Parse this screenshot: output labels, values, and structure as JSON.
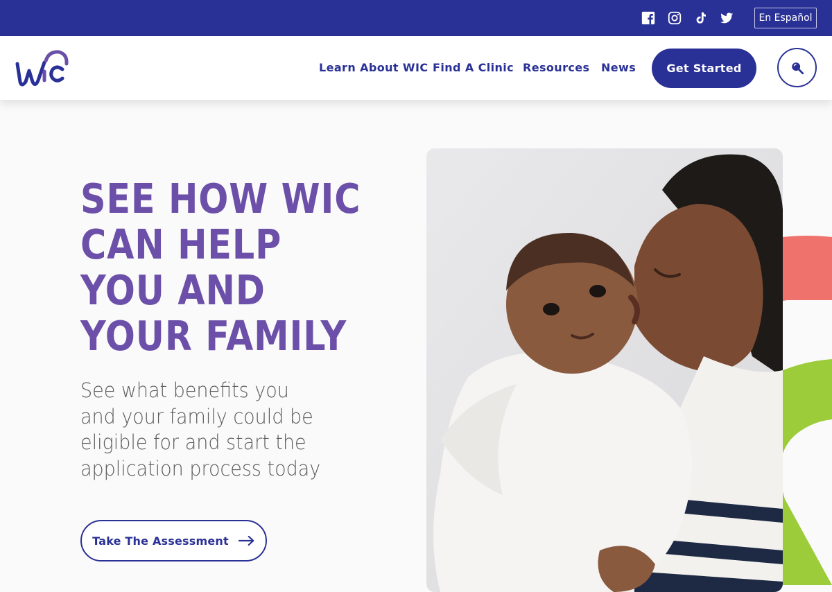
{
  "topbar": {
    "social_icons": [
      "facebook-icon",
      "instagram-icon",
      "tiktok-icon",
      "twitter-icon"
    ],
    "language_label": "En Español"
  },
  "navbar": {
    "logo_text": "wic",
    "links": [
      {
        "label": "Learn About WIC"
      },
      {
        "label": "Find A Clinic"
      },
      {
        "label": "Resources"
      },
      {
        "label": "News"
      }
    ],
    "cta_label": "Get Started",
    "search_icon": "search-icon"
  },
  "hero": {
    "title_lines": [
      "SEE HOW WIC",
      "CAN HELP",
      "YOU AND",
      "YOUR FAMILY"
    ],
    "subtitle": "See what benefits you and your family could be eligible for and start the application process today",
    "button_label": "Take The Assessment",
    "button_icon": "arrow-right-icon",
    "image_alt": "mother-kissing-baby-photo"
  },
  "colors": {
    "brand_navy": "#2a3196",
    "headline_purple": "#6b4fa8",
    "accent_coral": "#ef736c",
    "accent_green": "#9ccc3a"
  }
}
